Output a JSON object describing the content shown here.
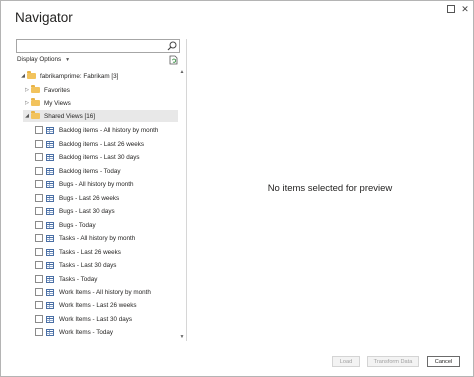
{
  "window": {
    "title": "Navigator"
  },
  "search": {
    "placeholder": ""
  },
  "display_options": {
    "label": "Display Options"
  },
  "tree": {
    "root": {
      "label": "fabrikamprime: Fabrikam [3]"
    },
    "folders": [
      {
        "label": "Favorites"
      },
      {
        "label": "My Views"
      },
      {
        "label": "Shared Views [16]"
      }
    ],
    "items": [
      {
        "label": "Backlog items - All history by month"
      },
      {
        "label": "Backlog items - Last 26 weeks"
      },
      {
        "label": "Backlog items - Last 30 days"
      },
      {
        "label": "Backlog items - Today"
      },
      {
        "label": "Bugs - All history by month"
      },
      {
        "label": "Bugs - Last 26 weeks"
      },
      {
        "label": "Bugs - Last 30 days"
      },
      {
        "label": "Bugs - Today"
      },
      {
        "label": "Tasks - All history by month"
      },
      {
        "label": "Tasks - Last 26 weeks"
      },
      {
        "label": "Tasks - Last 30 days"
      },
      {
        "label": "Tasks - Today"
      },
      {
        "label": "Work Items - All history by month"
      },
      {
        "label": "Work Items - Last 26 weeks"
      },
      {
        "label": "Work Items - Last 30 days"
      },
      {
        "label": "Work Items - Today"
      }
    ]
  },
  "preview": {
    "empty_message": "No items selected for preview"
  },
  "buttons": {
    "load": "Load",
    "transform": "Transform Data",
    "cancel": "Cancel"
  },
  "colors": {
    "folder": "#f2c35d",
    "table_icon": "#4a6fa5",
    "selected_row": "#e8e8e8"
  }
}
